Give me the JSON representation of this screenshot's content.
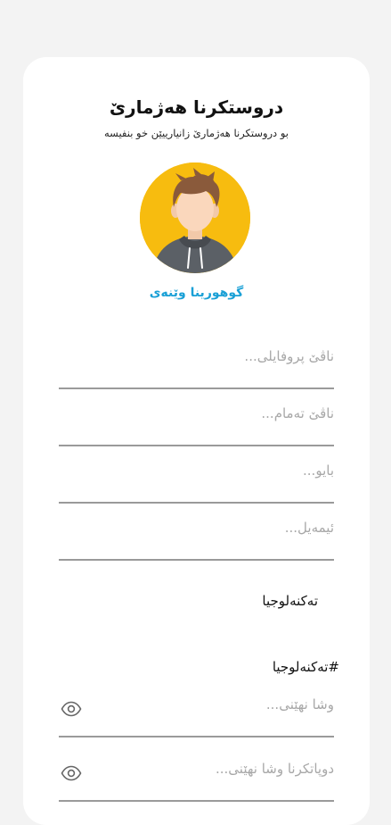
{
  "header": {
    "title": "دروستکرنا هەژمارێ",
    "subtitle": "بو دروستکرنا هەژمارێ زانیارییێن خو بنفیسە"
  },
  "avatar": {
    "change_photo_label": "گوهورینا وێنەی",
    "background_color": "#f7bc0f"
  },
  "form": {
    "profile_name_placeholder": "ناڤێ پروفایلی...",
    "full_name_placeholder": "ناڤێ تەمام...",
    "bio_placeholder": "بایو...",
    "email_placeholder": "ئیمەیل...",
    "technology_label": "تەکنەلوجیا",
    "technology_hashtag": "#تەکنەلوجیا",
    "password_placeholder": "وشا نهێنی...",
    "confirm_password_placeholder": "دوپاتکرنا وشا نهێنی..."
  },
  "colors": {
    "accent": "#1aa0d6",
    "underline": "#9a9a9a",
    "placeholder": "#a8a8a8"
  },
  "icons": {
    "password_toggle": "eye-icon"
  }
}
